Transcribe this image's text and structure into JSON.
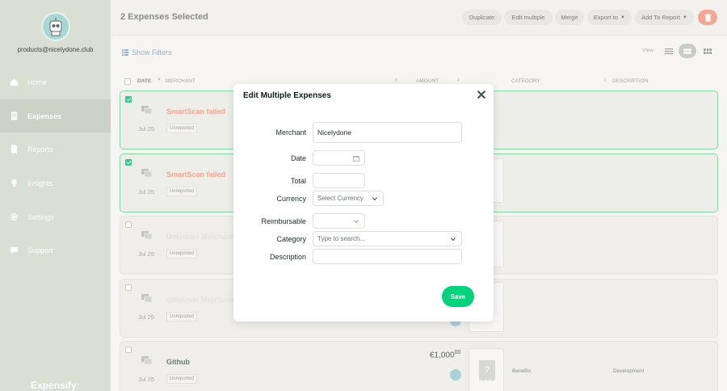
{
  "sidebar": {
    "email": "products@nicelydone.club",
    "items": [
      {
        "label": "Home",
        "icon": "home-icon",
        "active": false
      },
      {
        "label": "Expenses",
        "icon": "receipt-icon",
        "active": true
      },
      {
        "label": "Reports",
        "icon": "document-icon",
        "active": false
      },
      {
        "label": "Insights",
        "icon": "lightbulb-icon",
        "active": false
      },
      {
        "label": "Settings",
        "icon": "gear-icon",
        "active": false
      },
      {
        "label": "Support",
        "icon": "chat-icon",
        "active": false
      }
    ],
    "brand": "Expensify"
  },
  "header": {
    "title": "2 Expenses Selected",
    "buttons": {
      "duplicate": "Duplicate",
      "edit_multiple": "Edit multiple",
      "merge": "Merge",
      "export_to": "Export to",
      "add_to_report": "Add To Report"
    }
  },
  "toolbar": {
    "show_filters": "Show Filters",
    "view_label": "View"
  },
  "table": {
    "columns": {
      "date": "DATE",
      "merchant": "MERCHANT",
      "amount": "AMOUNT",
      "category": "CATEGORY",
      "description": "DESCRIPTION"
    },
    "rows": [
      {
        "date": "Jul 25",
        "merchant": "SmartScan failed",
        "status": "Unreported",
        "selected": true,
        "style": "failed"
      },
      {
        "date": "Jul 25",
        "merchant": "SmartScan failed",
        "status": "Unreported",
        "selected": true,
        "style": "failed"
      },
      {
        "date": "Jul 25",
        "merchant": "Unknown Merchant",
        "status": "Unreported",
        "selected": false,
        "style": "unknown"
      },
      {
        "date": "Jul 25",
        "merchant": "Unknown Merchant",
        "status": "Unreported",
        "selected": false,
        "style": "unknown"
      },
      {
        "date": "Jul 25",
        "merchant": "Github",
        "status": "Unreported",
        "selected": false,
        "style": "normal",
        "amount": "€1,000",
        "amount_cents": "00",
        "category": "Benefits",
        "description": "Development"
      }
    ]
  },
  "modal": {
    "title": "Edit Multiple Expenses",
    "labels": {
      "merchant": "Merchant",
      "date": "Date",
      "total": "Total",
      "currency": "Currency",
      "reimbursable": "Reimbursable",
      "category": "Category",
      "description": "Description"
    },
    "merchant_value": "Nicelydone",
    "currency_placeholder": "Select Currency",
    "category_placeholder": "Type to search...",
    "save_label": "Save"
  }
}
